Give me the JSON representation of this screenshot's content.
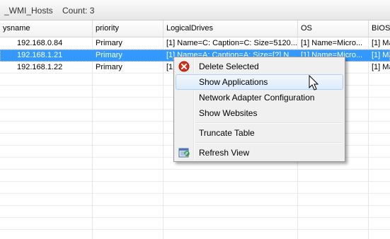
{
  "titlebar": {
    "name": "_WMI_Hosts",
    "count": "Count: 3"
  },
  "columns": [
    "ysname",
    "priority",
    "LogicalDrives",
    "OS",
    "BIOS"
  ],
  "rows": [
    {
      "host": "192.168.0.84",
      "priority": "Primary",
      "drives": "[1] Name=C: Caption=C: Size=5120...",
      "os": "[1] Name=Micro...",
      "bios": "[1] Ma",
      "selected": false
    },
    {
      "host": "192.168.1.21",
      "priority": "Primary",
      "drives": "[1] Name=A: Caption=A: Size=[?] N...",
      "os": "[1] Name=Micro...",
      "bios": "[1] Ma",
      "selected": true
    },
    {
      "host": "192.168.1.22",
      "priority": "Primary",
      "drives": "[1",
      "os": "",
      "bios": "[1] Ma",
      "selected": false
    }
  ],
  "context_menu": {
    "delete_selected": "Delete Selected",
    "show_applications": "Show Applications",
    "network_adapter": "Network Adapter Configuration",
    "show_websites": "Show Websites",
    "truncate_table": "Truncate Table",
    "refresh_view": "Refresh View"
  },
  "colors": {
    "selection": "#3399ff",
    "delete_icon": "#d9301c",
    "menu_bg": "#f0f0f0"
  }
}
